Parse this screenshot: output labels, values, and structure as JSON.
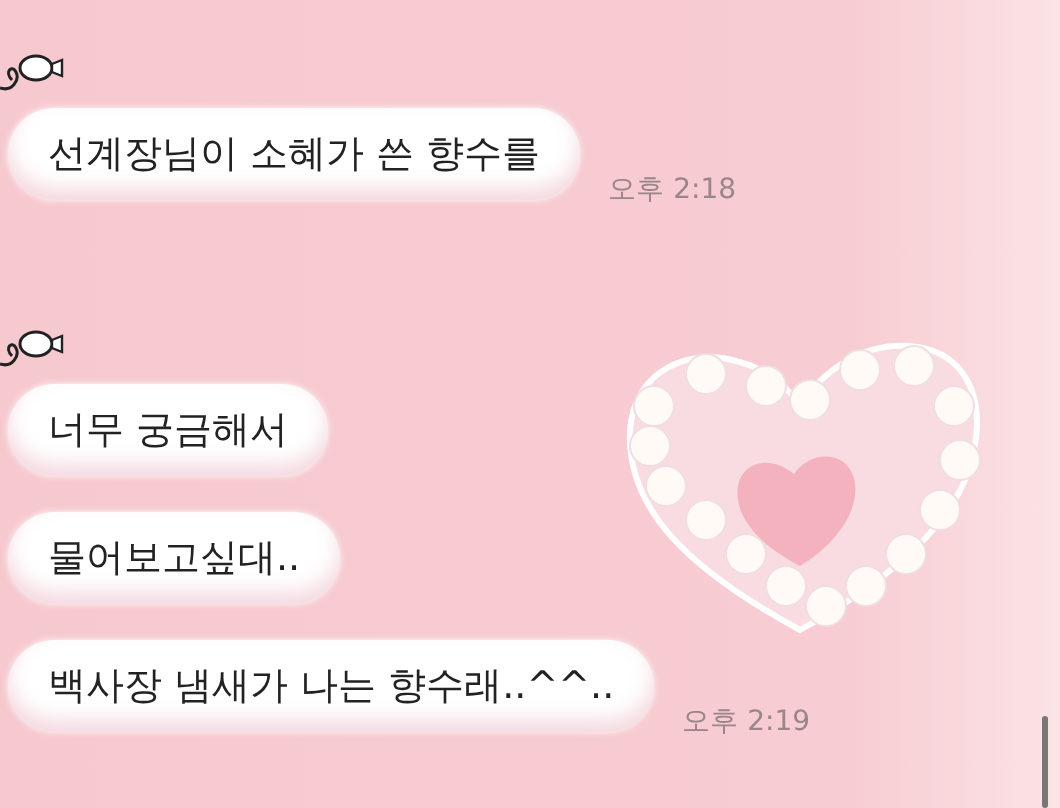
{
  "groups": [
    {
      "messages": [
        {
          "text": "선계장님이 소혜가 쓴 향수를"
        }
      ],
      "time": "오후 2:18"
    },
    {
      "messages": [
        {
          "text": "너무 궁금해서"
        },
        {
          "text": "물어보고싶대.."
        },
        {
          "text": "백사장 냄새가 나는 향수래..^^.."
        }
      ],
      "time": "오후 2:19"
    }
  ]
}
